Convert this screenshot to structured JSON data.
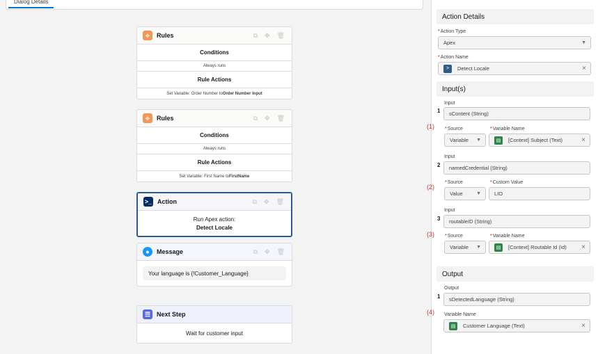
{
  "top_tab": "Dialog Details",
  "card_tools": {
    "copy_icon": "copy-icon",
    "move_icon": "move-icon",
    "delete_icon": "trash-icon"
  },
  "cards": {
    "rules1": {
      "title": "Rules",
      "conditions": "Conditions",
      "always": "Always runs",
      "actions": "Rule Actions",
      "set_prefix": "Set Variable: Order Number to ",
      "set_target": "Order Number Input"
    },
    "rules2": {
      "title": "Rules",
      "conditions": "Conditions",
      "always": "Always runs",
      "actions": "Rule Actions",
      "set_prefix": "Set Variable: First Name to ",
      "set_target": "FirstName"
    },
    "action": {
      "title": "Action",
      "line1": "Run Apex action:",
      "line2": "Detect Locale"
    },
    "message": {
      "title": "Message",
      "text": "Your language is {!Customer_Language}"
    },
    "next": {
      "title": "Next Step",
      "text": "Wait for customer input"
    }
  },
  "panel": {
    "action_details": "Action Details",
    "action_type_label": "Action Type",
    "action_type_value": "Apex",
    "action_name_label": "Action Name",
    "action_name_value": "Detect Locale",
    "inputs_head": "Input(s)",
    "inputs": [
      {
        "num": "1",
        "annotation": "(1)",
        "input_label": "Input",
        "input_value": "sContent (String)",
        "source_label": "Source",
        "source_value": "Variable",
        "target_label": "Variable Name",
        "target_value": "[Context] Subject (Text)"
      },
      {
        "num": "2",
        "annotation": "(2)",
        "input_label": "Input",
        "input_value": "namedCredential (String)",
        "source_label": "Source",
        "source_value": "Value",
        "target_label": "Custom Value",
        "target_value": "LIO"
      },
      {
        "num": "3",
        "annotation": "(3)",
        "input_label": "Input",
        "input_value": "routableID (String)",
        "source_label": "Source",
        "source_value": "Variable",
        "target_label": "Variable Name",
        "target_value": "[Context] Routable Id (Id)"
      }
    ],
    "output_head": "Output",
    "output": {
      "num": "1",
      "annotation": "(4)",
      "output_label": "Output",
      "output_value": "sDetectedLanguage (String)",
      "var_label": "Variable Name",
      "var_value": "Customer Language (Text)"
    },
    "required_mark": "*",
    "close_glyph": "×",
    "caret_glyph": "▼"
  }
}
